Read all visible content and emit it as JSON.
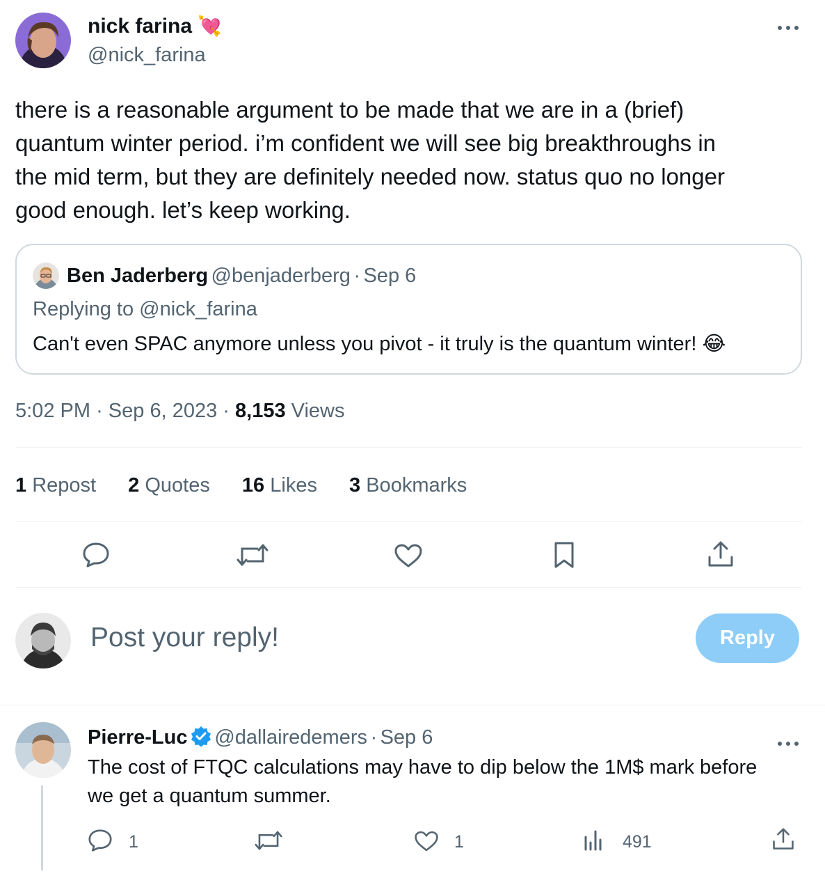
{
  "author": {
    "name": "nick farina",
    "emoji": "💘",
    "handle": "@nick_farina",
    "more_icon": "more-horizontal-icon"
  },
  "tweet": {
    "lines": [
      "there is a reasonable argument to be made that we are in a (brief)",
      "quantum winter period. i’m confident we will see big breakthroughs in",
      "the mid term, but they are definitely needed now. status quo no longer",
      "good enough. let’s keep working."
    ]
  },
  "quote": {
    "name": "Ben Jaderberg",
    "handle": "@benjaderberg",
    "separator": "·",
    "date": "Sep 6",
    "replying_to": "Replying to @nick_farina",
    "text": "Can't even SPAC anymore unless you pivot - it truly is the quantum winter!",
    "emoji": "😂"
  },
  "meta": {
    "time": "5:02 PM",
    "separator": "·",
    "date": "Sep 6, 2023",
    "views_count": "8,153",
    "views_label": "Views"
  },
  "stats": [
    {
      "count": "1",
      "label": "Repost"
    },
    {
      "count": "2",
      "label": "Quotes"
    },
    {
      "count": "16",
      "label": "Likes"
    },
    {
      "count": "3",
      "label": "Bookmarks"
    }
  ],
  "actions": [
    "reply-icon",
    "repost-icon",
    "like-icon",
    "bookmark-icon",
    "share-icon"
  ],
  "composer": {
    "placeholder": "Post your reply!",
    "button_label": "Reply",
    "button_color": "#8ecdf7"
  },
  "reply": {
    "name": "Pierre-Luc",
    "verified_icon": "verified-badge-icon",
    "handle": "@dallairedemers",
    "separator": "·",
    "date": "Sep 6",
    "lines": [
      "The cost of FTQC calculations may have to dip below the 1M$ mark before",
      "we get a quantum summer."
    ],
    "reply_count": "1",
    "like_count": "1",
    "views_count": "491"
  },
  "colors": {
    "text": "#0f1419",
    "secondary": "#536471",
    "border": "#cfd9de",
    "accent": "#1d9bf0"
  }
}
